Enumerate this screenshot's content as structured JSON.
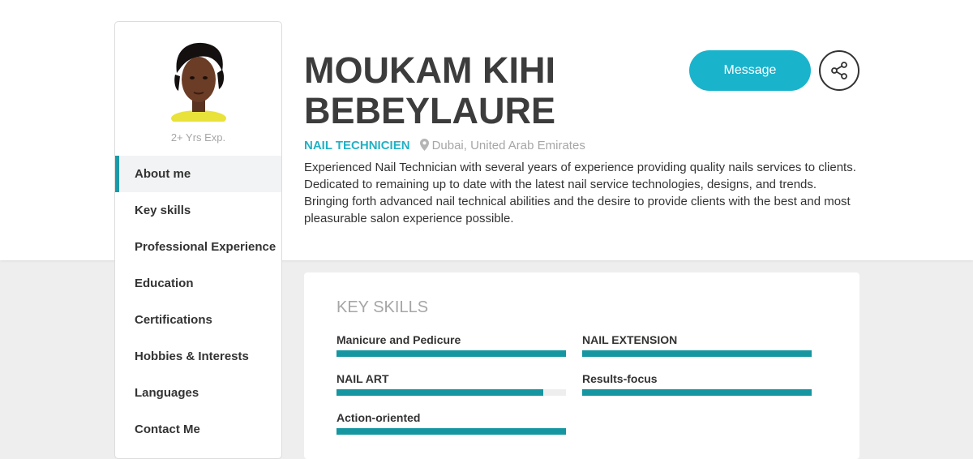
{
  "profile": {
    "name": "MOUKAM KIHI BEBEYLAURE",
    "experience": "2+ Yrs Exp.",
    "role": "NAIL TECHNICIEN",
    "location": "Dubai, United Arab Emirates",
    "bio": "Experienced Nail Technician with several years of experience providing quality nails services to clients. Dedicated to remaining up to date with the latest nail service technologies, designs, and trends. Bringing forth advanced nail technical abilities and the desire to provide clients with the best and most pleasurable salon experience possible."
  },
  "actions": {
    "message_label": "Message",
    "share_icon": "share-icon"
  },
  "nav": {
    "items": [
      {
        "label": "About me",
        "active": true
      },
      {
        "label": "Key skills"
      },
      {
        "label": "Professional Experience"
      },
      {
        "label": "Education"
      },
      {
        "label": "Certifications"
      },
      {
        "label": "Hobbies & Interests"
      },
      {
        "label": "Languages"
      },
      {
        "label": "Contact Me"
      }
    ]
  },
  "skills": {
    "title": "KEY SKILLS",
    "items": [
      {
        "label": "Manicure and Pedicure",
        "level": 1.0
      },
      {
        "label": "NAIL EXTENSION",
        "level": 1.0
      },
      {
        "label": "NAIL ART",
        "level": 0.9
      },
      {
        "label": "Results-focus",
        "level": 1.0
      },
      {
        "label": "Action-oriented",
        "level": 1.0
      }
    ]
  },
  "colors": {
    "accent": "#1ab3cc",
    "skill_bar": "#1596a0",
    "role": "#22b1c4"
  }
}
